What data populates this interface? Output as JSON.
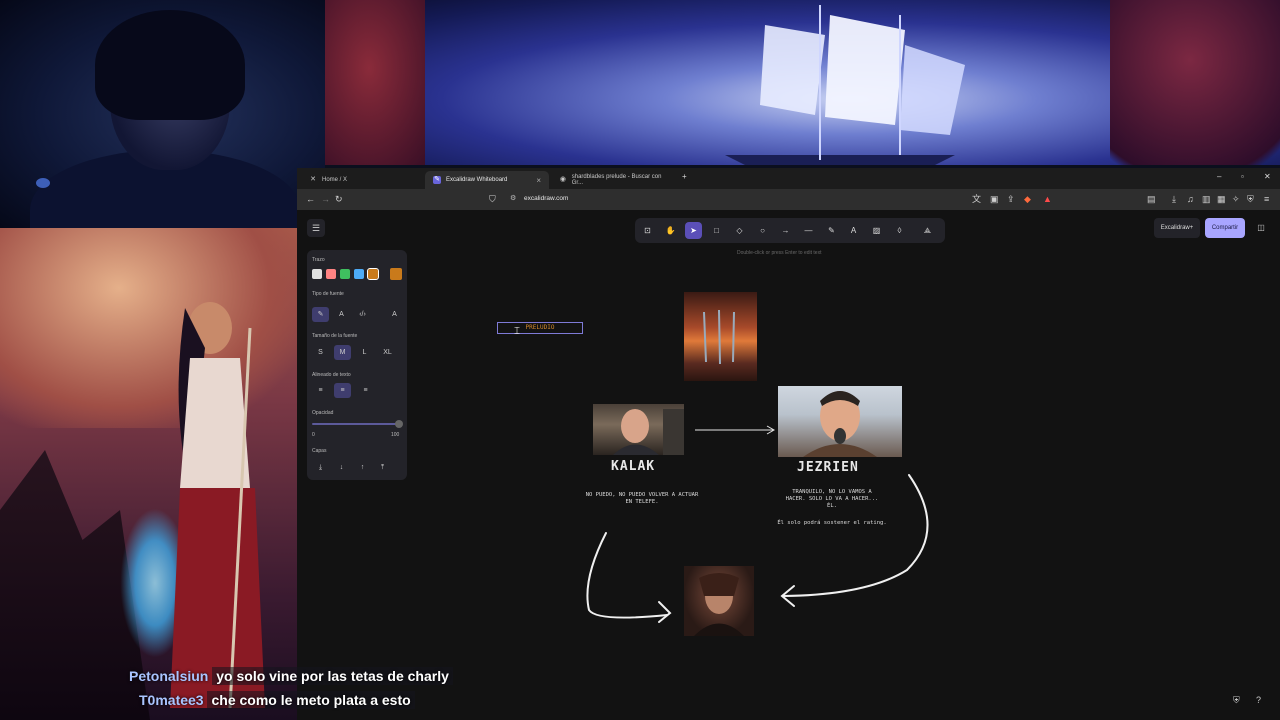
{
  "browser": {
    "tabs": [
      {
        "label": "Home / X",
        "icon": "x-logo-icon"
      },
      {
        "label": "Excalidraw Whiteboard",
        "icon": "excalidraw-logo-icon"
      },
      {
        "label": "shardblades prelude - Buscar con Gr...",
        "icon": "globe-icon"
      }
    ],
    "new_tab": "+",
    "url": "excalidraw.com"
  },
  "app": {
    "hint": "Double-click or press Enter to edit text",
    "library_label": "Excalidraw+",
    "share_label": "Compartir"
  },
  "props": {
    "stroke_label": "Trazo",
    "stroke_colors": [
      "#e0e0e0",
      "#ff8383",
      "#3fbf5f",
      "#4dabf7",
      "#c97a1b"
    ],
    "current_color": "#c97a1b",
    "font_family_label": "Tipo de fuente",
    "font_size_label": "Tamaño de la fuente",
    "sizes": [
      "S",
      "M",
      "L",
      "XL"
    ],
    "align_label": "Alineado de texto",
    "opacity_label": "Opacidad",
    "opacity_min": "0",
    "opacity_max": "100",
    "opacity_value": 100,
    "layers_label": "Capas"
  },
  "canvas": {
    "text_box": "PRELUDIO",
    "kalak_title": "KALAK",
    "jezrien_title": "JEZRIEN",
    "kalak_quote": [
      "NO PUEDO, NO PUEDO VOLVER A ACTUAR",
      "EN TELEFE."
    ],
    "jezrien_quote": [
      "TRANQUILO, NO LO VAMOS A",
      "HACER. SOLO LO VA A HACER...",
      "ÉL."
    ],
    "jezrien_note": "Él solo podrá sostener el rating."
  },
  "chat": [
    {
      "user": "Petonalsiun",
      "message": "yo solo vine por las tetas de charly"
    },
    {
      "user": "T0matee3",
      "message": "che como le meto plata a esto"
    }
  ]
}
